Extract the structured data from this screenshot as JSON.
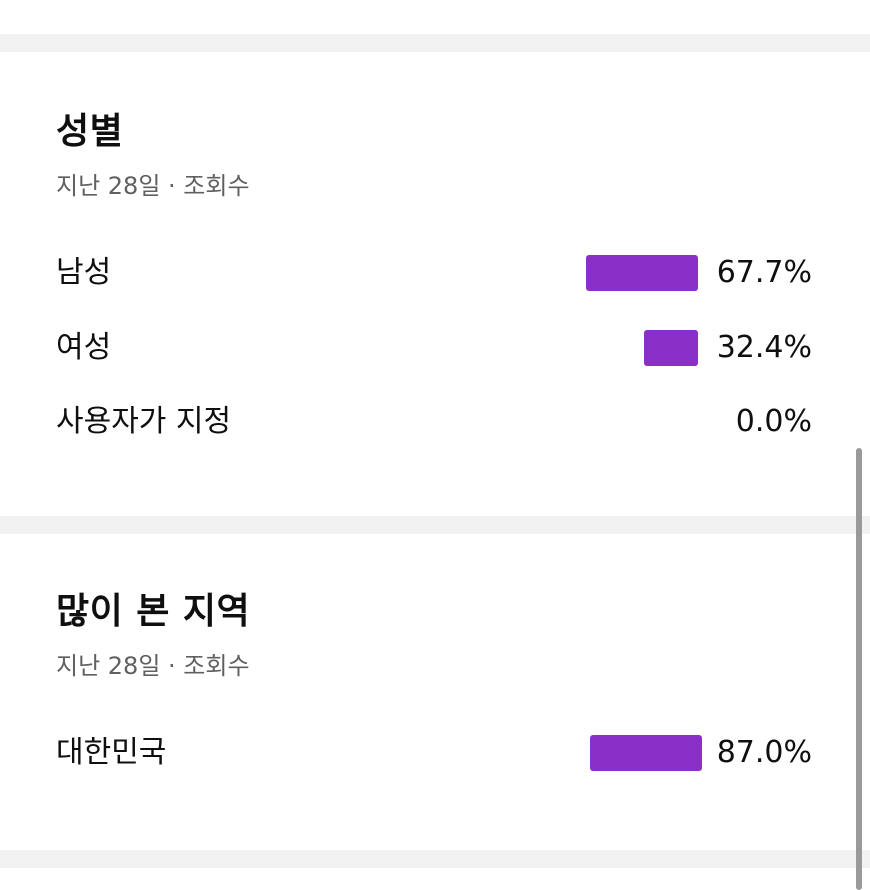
{
  "gender": {
    "title": "성별",
    "subtitle": "지난 28일 · 조회수",
    "rows": [
      {
        "label": "남성",
        "value": "67.7%",
        "fraction": 0.677
      },
      {
        "label": "여성",
        "value": "32.4%",
        "fraction": 0.324
      },
      {
        "label": "사용자가 지정",
        "value": "0.0%",
        "fraction": 0.0
      }
    ]
  },
  "regions": {
    "title": "많이 본 지역",
    "subtitle": "지난 28일 · 조회수",
    "rows": [
      {
        "label": "대한민국",
        "value": "87.0%",
        "fraction": 0.87
      }
    ]
  },
  "colors": {
    "bar": "#8b2fc9",
    "divider": "#f2f2f2",
    "subtitle": "#606060"
  }
}
